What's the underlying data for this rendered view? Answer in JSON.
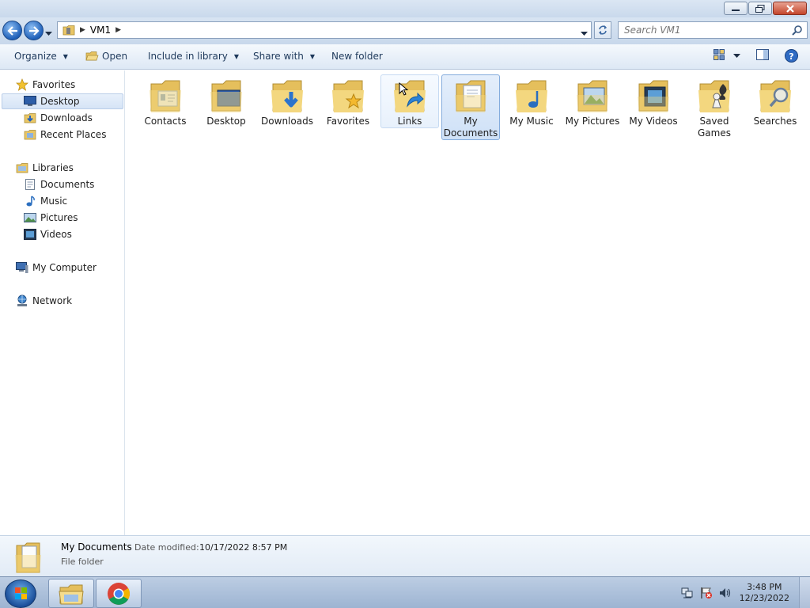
{
  "window": {
    "minimize_label": "Minimize",
    "maximize_label": "Maximize",
    "close_label": "Close"
  },
  "address": {
    "crumbs": [
      "VM1"
    ],
    "search_placeholder": "Search VM1"
  },
  "toolbar": {
    "organize": "Organize",
    "open": "Open",
    "include_in_library": "Include in library",
    "share_with": "Share with",
    "new_folder": "New folder"
  },
  "nav": {
    "favorites": "Favorites",
    "desktop": "Desktop",
    "downloads": "Downloads",
    "recent_places": "Recent Places",
    "libraries": "Libraries",
    "documents": "Documents",
    "music": "Music",
    "pictures": "Pictures",
    "videos": "Videos",
    "my_computer": "My Computer",
    "network": "Network"
  },
  "folders": [
    {
      "label": "Contacts",
      "icon": "contacts-folder-icon"
    },
    {
      "label": "Desktop",
      "icon": "desktop-folder-icon"
    },
    {
      "label": "Downloads",
      "icon": "downloads-folder-icon"
    },
    {
      "label": "Favorites",
      "icon": "favorites-folder-icon"
    },
    {
      "label": "Links",
      "icon": "links-folder-icon"
    },
    {
      "label": "My Documents",
      "icon": "documents-folder-icon"
    },
    {
      "label": "My Music",
      "icon": "music-folder-icon"
    },
    {
      "label": "My Pictures",
      "icon": "pictures-folder-icon"
    },
    {
      "label": "My Videos",
      "icon": "videos-folder-icon"
    },
    {
      "label": "Saved Games",
      "icon": "saved-games-folder-icon"
    },
    {
      "label": "Searches",
      "icon": "searches-folder-icon"
    }
  ],
  "details": {
    "name": "My Documents",
    "modified_label": "Date modified:",
    "modified_value": "10/17/2022 8:57 PM",
    "type": "File folder"
  },
  "taskbar": {
    "time": "3:48 PM",
    "date": "12/23/2022"
  },
  "colors": {
    "selection_border": "#84acdd",
    "hover_border": "#c6daf2",
    "folder_yellow": "#f2d479"
  }
}
